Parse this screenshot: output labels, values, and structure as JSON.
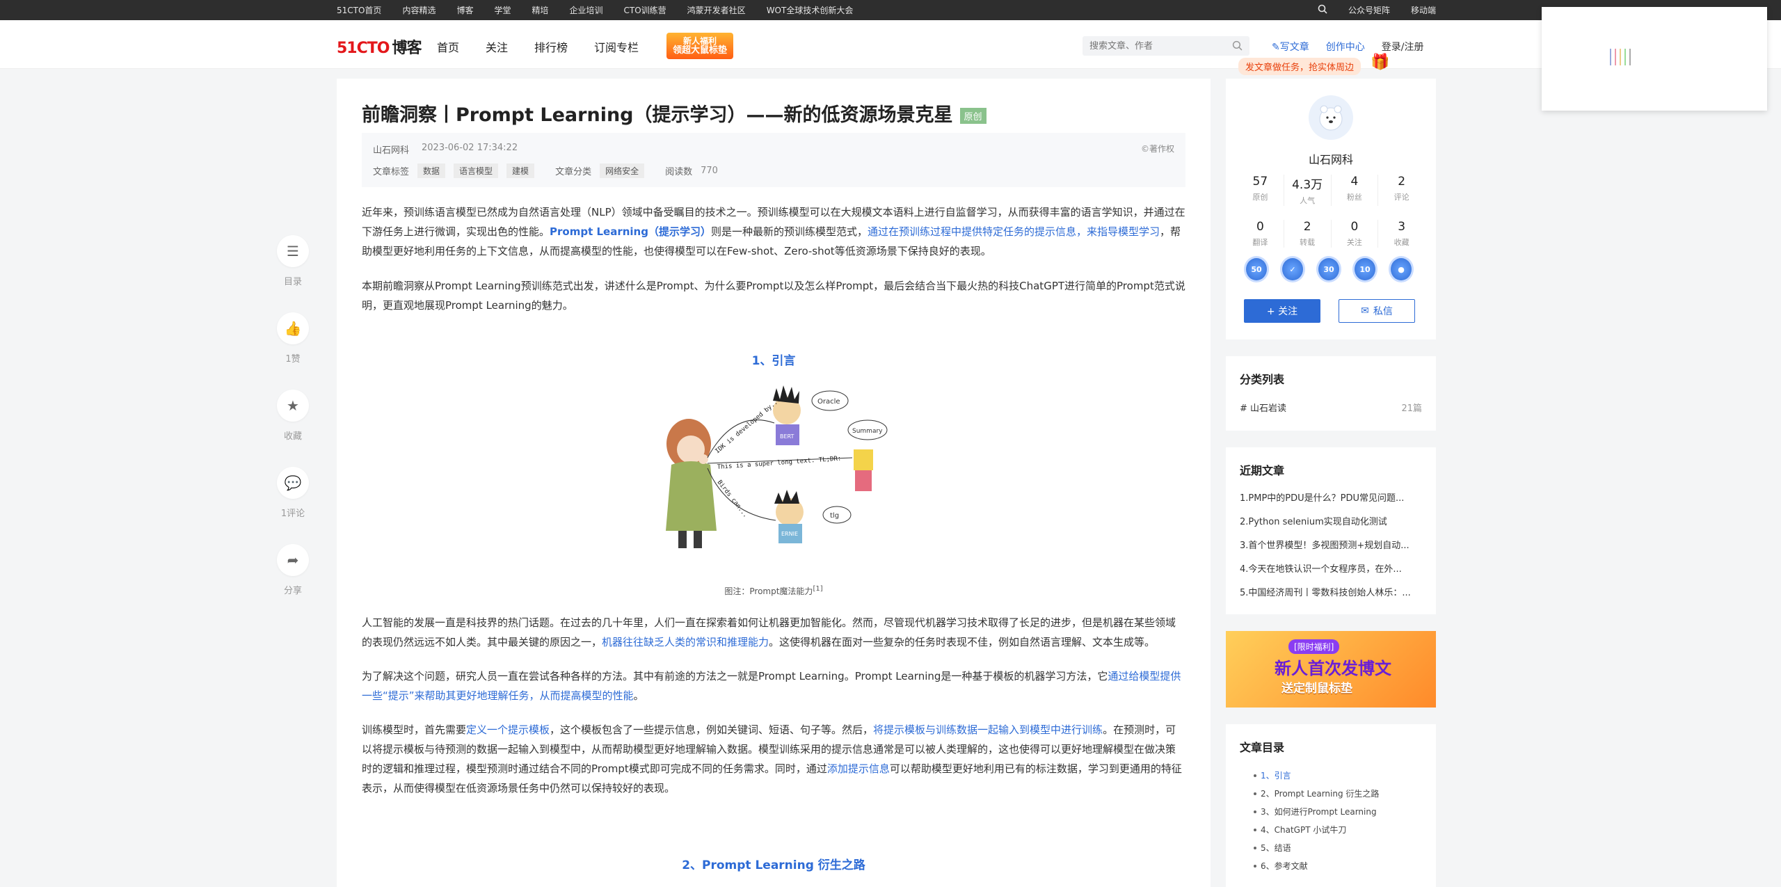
{
  "topbar": {
    "nav": [
      "51CTO首页",
      "内容精选",
      "博客",
      "学堂",
      "精培",
      "企业培训",
      "CTO训练营",
      "鸿蒙开发者社区",
      "WOT全球技术创新大会"
    ],
    "right": [
      "公众号矩阵",
      "移动端"
    ]
  },
  "header": {
    "logo_brand": "51CTO",
    "logo_product": "博客",
    "nav": [
      "首页",
      "关注",
      "排行榜",
      "订阅专栏"
    ],
    "promo_line1": "新人福利",
    "promo_line2": "领超大鼠标垫",
    "search_placeholder": "搜索文章、作者",
    "write": "写文章",
    "creator_center": "创作中心",
    "login": "登录/注册",
    "task_banner": "发文章做任务，抢实体周边"
  },
  "rail": {
    "toc": "目录",
    "like": "1赞",
    "collect": "收藏",
    "comment": "1评论",
    "share": "分享"
  },
  "article": {
    "title": "前瞻洞察丨Prompt Learning（提示学习）——新的低资源场景克星",
    "original_badge": "原创",
    "author": "山石网科",
    "time": "2023-06-02 17:34:22",
    "copyright": "©著作权",
    "tags_label": "文章标签",
    "tags": [
      "数据",
      "语言模型",
      "建模"
    ],
    "category_label": "文章分类",
    "category": "网络安全",
    "reads_label": "阅读数",
    "reads": "770",
    "p1_a": "近年来，预训练语言模型已然成为自然语言处理（NLP）领域中备受瞩目的技术之一。预训练模型可以在大规模文本语料上进行自监督学习，从而获得丰富的语言学知识，并通过在下游任务上进行微调，实现出色的性能。",
    "p1_link1": "Prompt Learning（提示学习）",
    "p1_b": "则是一种最新的预训练模型范式，",
    "p1_link2": "通过在预训练过程中提供特定任务的提示信息，来指导模型学习",
    "p1_c": "，帮助模型更好地利用任务的上下文信息，从而提高模型的性能，也使得模型可以在Few-shot、Zero-shot等低资源场景下保持良好的表现。",
    "p2": "本期前瞻洞察从Prompt Learning预训练范式出发，讲述什么是Prompt、为什么要Prompt以及怎么样Prompt，最后会结合当下最火热的科技ChatGPT进行简单的Prompt范式说明，更直观地展现Prompt Learning的魅力。",
    "h_intro": "1、引言",
    "fig_caption": "图注：Prompt魔法能力",
    "fig_ref": "[1]",
    "fig_texts": {
      "oracle": "Oracle",
      "summary": "Summary",
      "bert": "BERT",
      "ernie": "ERNIE",
      "tlg": "tlg",
      "developed": "IDK is developed by...",
      "long": "This is a super long text. TL;DR:",
      "birds": "Birds can..."
    },
    "p3_a": "人工智能的发展一直是科技界的热门话题。在过去的几十年里，人们一直在探索着如何让机器更加智能化。然而，尽管现代机器学习技术取得了长足的进步，但是机器在某些领域的表现仍然远远不如人类。其中最关键的原因之一，",
    "p3_link": "机器往往缺乏人类的常识和推理能力",
    "p3_b": "。这使得机器在面对一些复杂的任务时表现不佳，例如自然语言理解、文本生成等。",
    "p4_a": "为了解决这个问题，研究人员一直在尝试各种各样的方法。其中有前途的方法之一就是Prompt Learning。Prompt Learning是一种基于模板的机器学习方法，它",
    "p4_link": "通过给模型提供一些“提示”来帮助其更好地理解任务，从而提高模型的性能",
    "p4_b": "。",
    "p5_a": "训练模型时，首先需要",
    "p5_link1": "定义一个提示模板",
    "p5_b": "，这个模板包含了一些提示信息，例如关键词、短语、句子等。然后，",
    "p5_link2": "将提示模板与训练数据一起输入到模型中进行训练",
    "p5_c": "。在预测时，可以将提示模板与待预测的数据一起输入到模型中，从而帮助模型更好地理解输入数据。模型训练采用的提示信息通常是可以被人类理解的，这也使得可以更好地理解模型在做决策时的逻辑和推理过程，模型预测时通过结合不同的Prompt模式即可完成不同的任务需求。同时，通过",
    "p5_link3": "添加提示信息",
    "p5_d": "可以帮助模型更好地利用已有的标注数据，学习到更通用的特征表示，从而使得模型在低资源场景任务中仍然可以保持较好的表现。",
    "h_evolution": "2、Prompt Learning 衍生之路"
  },
  "profile": {
    "name": "山石网科",
    "stats1": [
      {
        "n": "57",
        "l": "原创"
      },
      {
        "n": "4.3万",
        "l": "人气"
      },
      {
        "n": "4",
        "l": "粉丝"
      },
      {
        "n": "2",
        "l": "评论"
      }
    ],
    "stats2": [
      {
        "n": "0",
        "l": "翻译"
      },
      {
        "n": "2",
        "l": "转载"
      },
      {
        "n": "0",
        "l": "关注"
      },
      {
        "n": "3",
        "l": "收藏"
      }
    ],
    "medals": [
      "50",
      "✓",
      "30",
      "10",
      "●"
    ],
    "follow": "+ 关注",
    "message": "私信"
  },
  "categories": {
    "title": "分类列表",
    "items": [
      {
        "name": "# 山石岩读",
        "count": "21篇"
      }
    ]
  },
  "recent": {
    "title": "近期文章",
    "items": [
      "1.PMP中的PDU是什么？PDU常见问题...",
      "2.Python selenium实现自动化测试",
      "3.首个世界模型！多视图预测+规划自动...",
      "4.今天在地铁认识一个女程序员，在外...",
      "5.中国经济周刊丨零数科技创始人林乐：..."
    ]
  },
  "ad": {
    "line1": "[限时福利]",
    "line2": "新人首次发博文",
    "line3": "送定制鼠标垫"
  },
  "toc": {
    "title": "文章目录",
    "items": [
      "1、引言",
      "2、Prompt Learning 衍生之路",
      "3、如何进行Prompt Learning",
      "4、ChatGPT 小试牛刀",
      "5、结语",
      "6、参考文献"
    ]
  },
  "colors": {
    "accent": "#2d6bd6",
    "brand": "#e3171b",
    "topbar": "#2e2e2e"
  }
}
